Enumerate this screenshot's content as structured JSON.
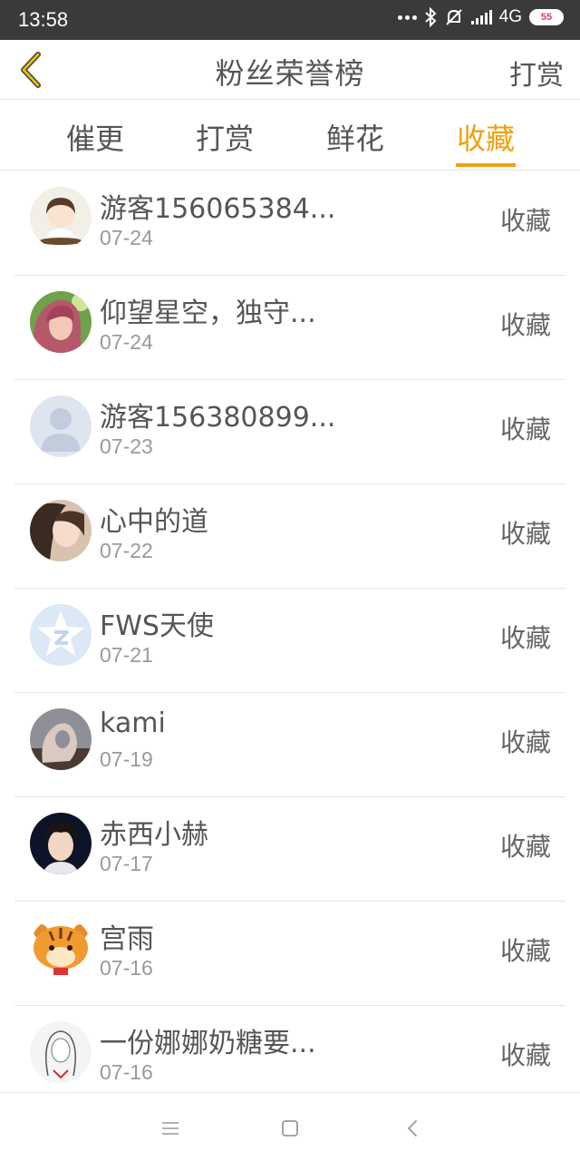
{
  "status": {
    "time": "13:58",
    "network": "4G",
    "battery": "55"
  },
  "header": {
    "title": "粉丝荣誉榜",
    "right_action": "打赏"
  },
  "tabs": [
    {
      "label": "催更",
      "active": false
    },
    {
      "label": "打赏",
      "active": false
    },
    {
      "label": "鲜花",
      "active": false
    },
    {
      "label": "收藏",
      "active": true
    }
  ],
  "items": [
    {
      "name": "游客156065384...",
      "date": "07-24",
      "action": "收藏",
      "avatar": "cartoon-girl-avatar"
    },
    {
      "name": "仰望星空，独守...",
      "date": "07-24",
      "action": "收藏",
      "avatar": "pink-hair-girl-avatar"
    },
    {
      "name": "游客156380899...",
      "date": "07-23",
      "action": "收藏",
      "avatar": "default-user-avatar"
    },
    {
      "name": "心中的道",
      "date": "07-22",
      "action": "收藏",
      "avatar": "girl-photo-avatar"
    },
    {
      "name": "FWS天使",
      "date": "07-21",
      "action": "收藏",
      "avatar": "qzone-star-avatar"
    },
    {
      "name": "kami",
      "date": "07-19",
      "action": "收藏",
      "avatar": "hand-photo-avatar"
    },
    {
      "name": "赤西小赫",
      "date": "07-17",
      "action": "收藏",
      "avatar": "boy-photo-avatar"
    },
    {
      "name": "宫雨",
      "date": "07-16",
      "action": "收藏",
      "avatar": "tiger-cartoon-avatar"
    },
    {
      "name": "一份娜娜奶糖要...",
      "date": "07-16",
      "action": "收藏",
      "avatar": "sketch-girl-avatar"
    }
  ],
  "colors": {
    "accent": "#f0a010",
    "text": "#555555",
    "subtext": "#9a9a9a",
    "statusbar": "#3a3a3a"
  }
}
